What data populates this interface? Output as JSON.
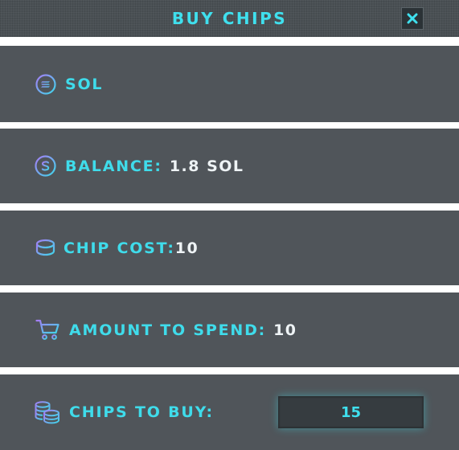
{
  "header": {
    "title": "BUY CHIPS",
    "close_icon": "close-icon"
  },
  "rows": {
    "currency": {
      "icon": "solana-icon",
      "label": "SOL"
    },
    "balance": {
      "icon": "dollar-coin-icon",
      "label": "BALANCE:",
      "value": "1.8 SOL"
    },
    "chip_cost": {
      "icon": "chip-icon",
      "label": "CHIP COST:",
      "value": "10"
    },
    "amount_to_spend": {
      "icon": "cart-icon",
      "label": "AMOUNT TO SPEND:",
      "value": "10"
    },
    "chips_to_buy": {
      "icon": "chip-stack-icon",
      "label": "CHIPS TO BUY:",
      "input_value": "15"
    }
  },
  "colors": {
    "accent": "#3fe0ee",
    "icon_gradient_start": "#a57cf5",
    "icon_gradient_end": "#3fd6ea",
    "row_background": "#50555a",
    "header_background": "#4a5054",
    "value_text": "#eef3f5"
  }
}
